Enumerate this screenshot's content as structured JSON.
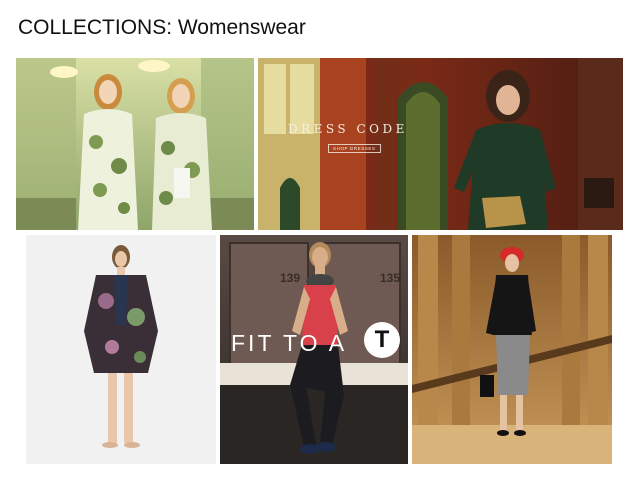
{
  "page": {
    "title": "COLLECTIONS: Womenswear"
  },
  "tiles": [
    {
      "name": "floral-coats-campaign",
      "text": ""
    },
    {
      "name": "dress-code-campaign",
      "headline": "DRESS CODE",
      "cta": "SHOP DRESSES"
    },
    {
      "name": "floral-kimono-product",
      "text": ""
    },
    {
      "name": "fit-to-a-t-campaign",
      "headline": "FIT TO A",
      "badge": "T",
      "locker_numbers": [
        "139",
        "135"
      ]
    },
    {
      "name": "red-hat-outfit-campaign",
      "text": ""
    }
  ],
  "colors": {
    "background": "#ffffff",
    "title_text": "#111111",
    "floral_bg": "#b9c78a",
    "dress_code_bg": "#6b2418",
    "kimono_bg": "#f1f1f1",
    "fit_bg": "#3a3432",
    "fit_accent": "#d8404a",
    "hat_accent": "#d42a2a",
    "hall_bg": "#b88a4a"
  }
}
